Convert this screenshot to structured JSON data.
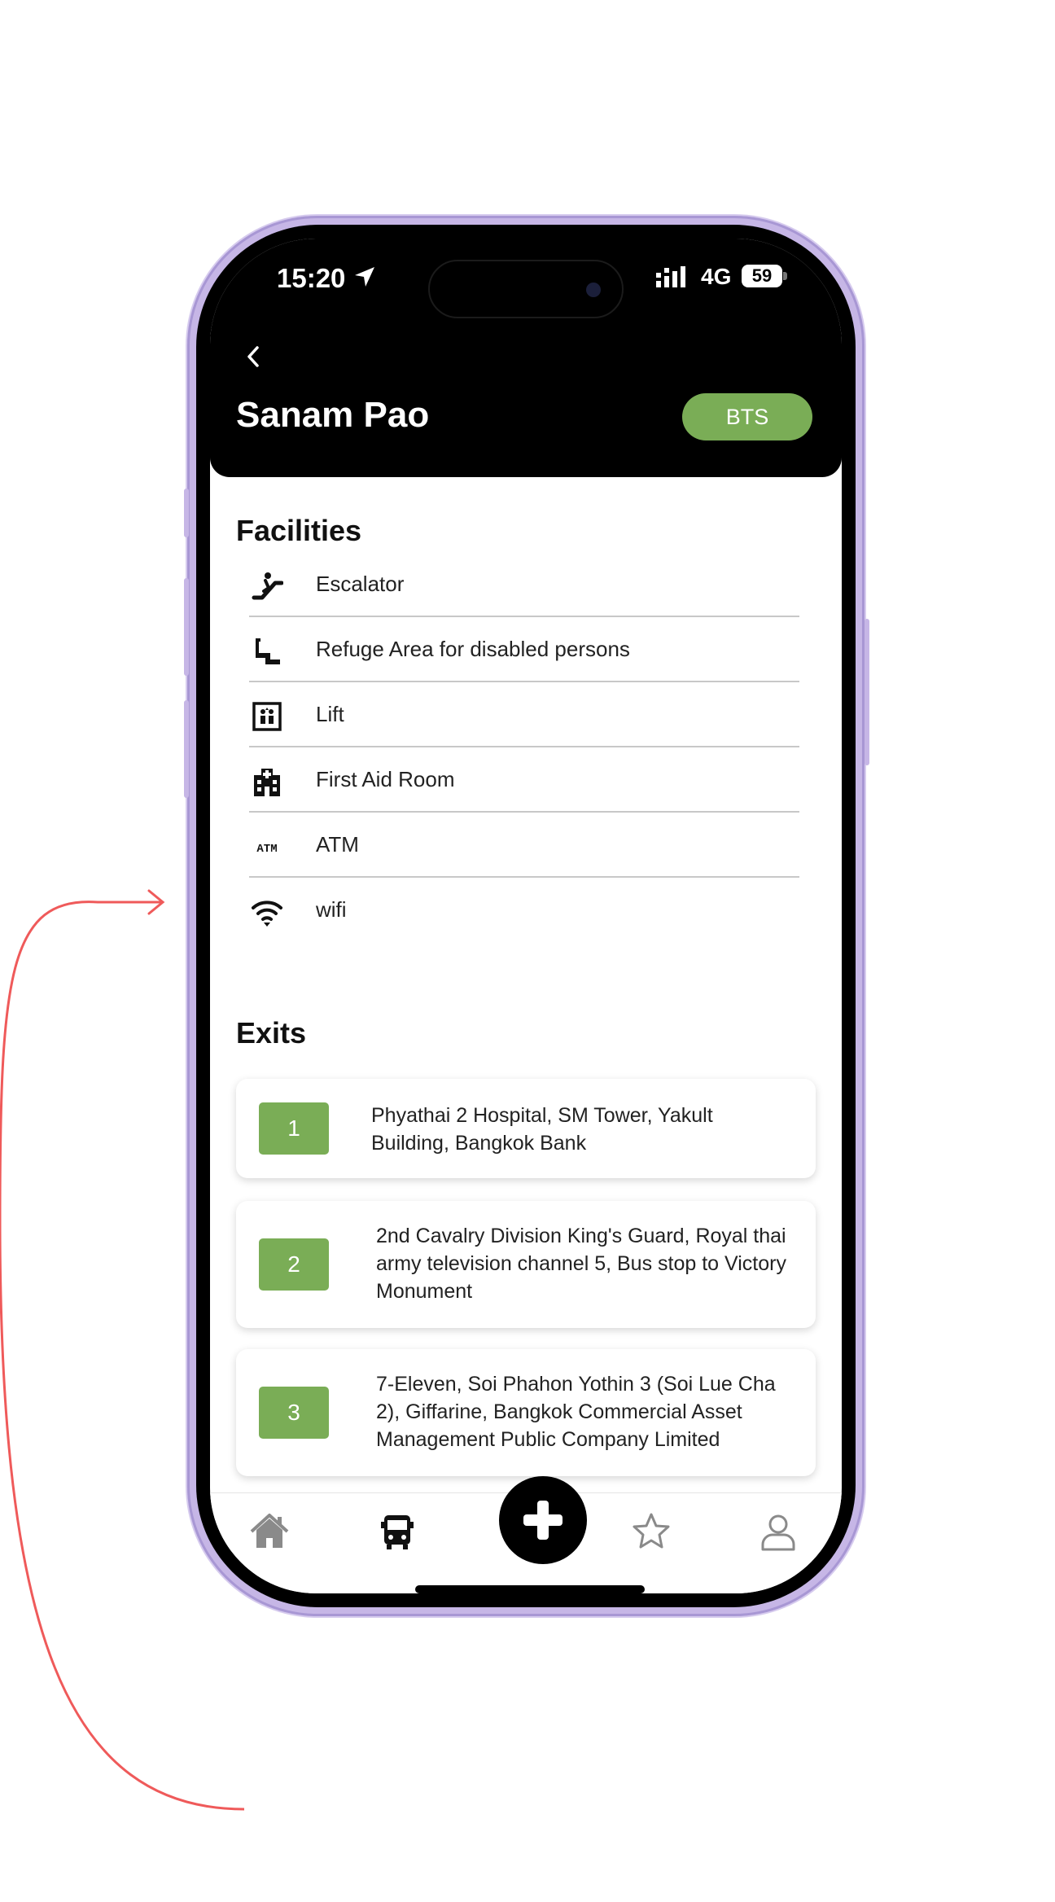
{
  "status_bar": {
    "time": "15:20",
    "network": "4G",
    "battery": "59"
  },
  "header": {
    "title": "Sanam Pao",
    "line_badge": "BTS",
    "line_color": "#7aad56"
  },
  "facilities": {
    "title": "Facilities",
    "items": [
      {
        "icon": "escalator-icon",
        "label": "Escalator"
      },
      {
        "icon": "wheelchair-icon",
        "label": "Refuge Area for disabled persons"
      },
      {
        "icon": "elevator-icon",
        "label": "Lift"
      },
      {
        "icon": "hospital-icon",
        "label": "First Aid Room"
      },
      {
        "icon": "atm-icon",
        "label": "ATM"
      },
      {
        "icon": "wifi-icon",
        "label": "wifi"
      }
    ]
  },
  "atm_icon_text": "ATM",
  "exits": {
    "title": "Exits",
    "items": [
      {
        "number": "1",
        "description": "Phyathai 2 Hospital, SM Tower, Yakult Building, Bangkok Bank"
      },
      {
        "number": "2",
        "description": "2nd Cavalry Division King's Guard, Royal thai army television channel 5, Bus stop to Victory Monument"
      },
      {
        "number": "3",
        "description": "7-Eleven, Soi Phahon Yothin 3 (Soi Lue Cha 2), Giffarine, Bangkok Commercial Asset Management Public Company Limited"
      }
    ]
  },
  "bottom_nav": {
    "items": [
      "home-icon",
      "bus-icon",
      "add-icon",
      "star-icon",
      "profile-icon"
    ],
    "active": "bus-icon"
  },
  "colors": {
    "accent": "#7aad56",
    "header_bg": "#000000",
    "annotation": "#ef5a5a",
    "phone_frame": "#c6b6e6"
  }
}
